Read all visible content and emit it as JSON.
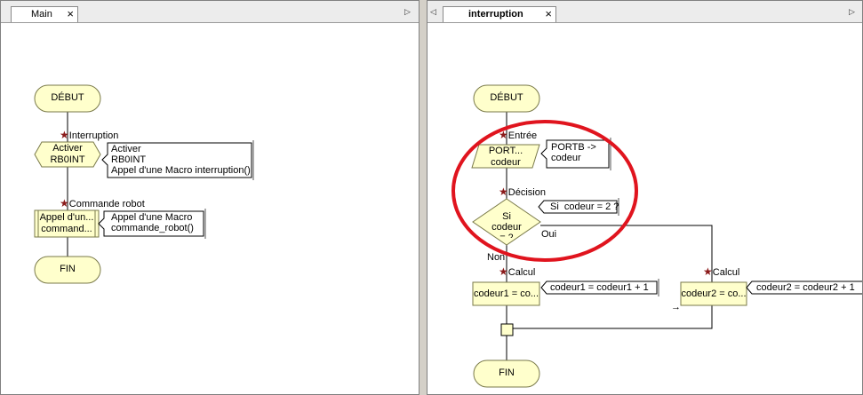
{
  "colors": {
    "node_fill": "#ffffcc",
    "node_stroke": "#7a7a4a",
    "highlight": "#e0141e"
  },
  "left_panel": {
    "tab_label": "Main",
    "nodes": {
      "debut": "DÉBUT",
      "interrupt_caption": "Interruption",
      "interrupt_box": "Activer\nRB0INT",
      "interrupt_comment": "Activer\nRB0INT\nAppel d'une Macro interruption()",
      "macro_caption": "Commande robot",
      "macro_box": "Appel d'un...\ncommand...",
      "macro_comment": "Appel d'une Macro\ncommande_robot()",
      "fin": "FIN"
    }
  },
  "right_panel": {
    "tab_label": "interruption",
    "nodes": {
      "debut": "DÉBUT",
      "entree_caption": "Entrée",
      "entree_box": "PORT...\ncodeur",
      "entree_comment": "PORTB ->\ncodeur",
      "decision_caption": "Décision",
      "decision_box": "Si\ncodeur\n= 2",
      "decision_comment": "Si  codeur = 2 ?",
      "oui": "Oui",
      "non": "Non",
      "calcul1_caption": "Calcul",
      "calcul1_box": "codeur1 = co...",
      "calcul1_comment": "codeur1 = codeur1 + 1",
      "calcul2_caption": "Calcul",
      "calcul2_box": "codeur2 = co...",
      "calcul2_comment": "codeur2 = codeur2 + 1",
      "fin": "FIN"
    }
  }
}
